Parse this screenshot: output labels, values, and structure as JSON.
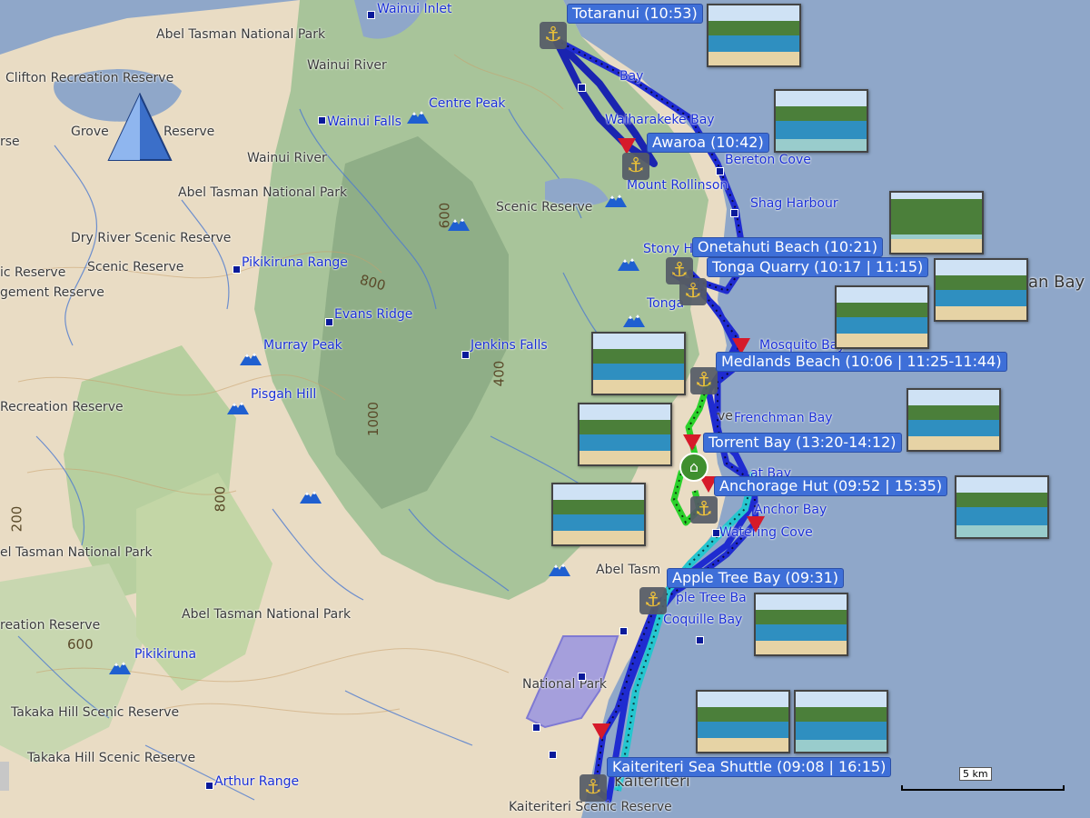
{
  "place_labels": [
    "Abel Tasman National Park",
    "Wainui River",
    "Clifton Recreation Reserve",
    "Grove",
    "Reserve",
    "Wainui River",
    "Abel Tasman National Park",
    "Dry River Scenic Reserve",
    "Scenic Reserve",
    "ic Reserve",
    "gement Reserve",
    "Recreation Reserve",
    "el Tasman National Park",
    "Abel Tasman National Park",
    "reation Reserve",
    "Takaka Hill Scenic Reserve",
    "Takaka Hill Scenic Reserve",
    "Scenic Reserve",
    "National Park",
    "Abel Tasm",
    "Kaiteriteri Scenic Reserve",
    "Kaiteriteri",
    "an Bay",
    "ve",
    "rse"
  ],
  "blue_labels": [
    "Wainui Inlet",
    "Centre Peak",
    "Wainui Falls",
    "Pikikiruna Range",
    "Evans Ridge",
    "Jenkins Falls",
    "Murray Peak",
    "Pisgah Hill",
    "Pikikiruna",
    "Arthur Range",
    "Bay",
    "Waiharakeke Bay",
    "Mount Rollinson",
    "Bereton Cove",
    "Shag Harbour",
    "Stony H",
    "Tonga",
    "Mosquito Bay",
    "Frenchman Bay",
    "Anchor Bay",
    "Watering Cove",
    "ple Tree Ba",
    "Coquille Bay",
    "at Bay"
  ],
  "elevation_labels": [
    "600",
    "800",
    "400",
    "1000",
    "800",
    "200",
    "600"
  ],
  "stops": [
    "Totaranui (10:53)",
    "Awaroa (10:42)",
    "Onetahuti Beach (10:21)",
    "Tonga Quarry (10:17 | 11:15)",
    "Medlands Beach (10:06 | 11:25-11:44)",
    "Torrent Bay (13:20-14:12)",
    "Anchorage Hut (09:52 | 15:35)",
    "Apple Tree Bay (09:31)",
    "Kaiteriteri Sea Shuttle (09:08 | 16:15)"
  ],
  "scale_label": "5 km",
  "colors": {
    "sea": "#8fa7c9",
    "route_dark": "#2433c8",
    "route_cyan": "#25c6cf",
    "route_green": "#2bd12b",
    "pin": "#d61a2a",
    "label_bg": "#3e6fd8"
  },
  "icons": [
    "anchor-icon",
    "flag-pin-icon",
    "mountain-peak-icon",
    "north-arrow-icon",
    "hut-icon"
  ]
}
